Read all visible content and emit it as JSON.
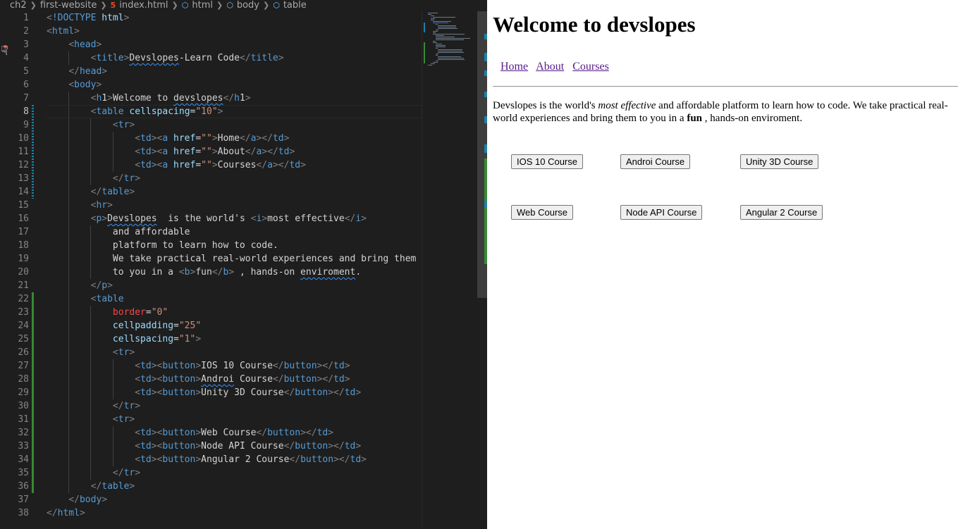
{
  "breadcrumb": [
    "ch2",
    "first-website",
    "index.html",
    "html",
    "body",
    "table"
  ],
  "active_line": 8,
  "code_lines": [
    "<!DOCTYPE html>",
    "<html>",
    "    <head>",
    "        <title>Devslopes-Learn Code</title>",
    "    </head>",
    "    <body>",
    "        <h1>Welcome to devslopes</h1>",
    "        <table cellspacing=\"10\">",
    "            <tr>",
    "                <td><a href=\"\">Home</a></td>",
    "                <td><a href=\"\">About</a></td>",
    "                <td><a href=\"\">Courses</a></td>",
    "            </tr>",
    "        </table>",
    "        <hr>",
    "        <p>Devslopes  is the world's <i>most effective</i>",
    "            and affordable",
    "            platform to learn how to code.",
    "            We take practical real-world experiences and bring them",
    "            to you in a <b>fun</b> , hands-on enviroment.",
    "        </p>",
    "        <table",
    "            border=\"0\"",
    "            cellpadding=\"25\"",
    "            cellspacing=\"1\">",
    "            <tr>",
    "                <td><button>IOS 10 Course</button></td>",
    "                <td><button>Androi Course</button></td>",
    "                <td><button>Unity 3D Course</button></td>",
    "            </tr>",
    "            <tr>",
    "                <td><button>Web Course</button></td>",
    "                <td><button>Node API Course</button></td>",
    "                <td><button>Angular 2 Course</button></td>",
    "            </tr>",
    "        </table>",
    "    </body>",
    "</html>"
  ],
  "squiggles": [
    "Devslopes",
    "devslopes",
    "Devslopes",
    "enviroment",
    "Androi"
  ],
  "preview": {
    "heading": "Welcome to devslopes",
    "nav_links": [
      "Home",
      "About",
      "Courses"
    ],
    "paragraph": {
      "before_italic": "Devslopes is the world's ",
      "italic": "most effective",
      "middle": " and affordable platform to learn how to code. We take practical real-world experiences and bring them to you in a ",
      "bold": "fun",
      "after": " , hands-on enviroment."
    },
    "buttons": [
      "IOS 10 Course",
      "Androi Course",
      "Unity 3D Course",
      "Web Course",
      "Node API Course",
      "Angular 2 Course"
    ]
  },
  "colors": {
    "editor_bg": "#1e1e1e",
    "tag": "#569cd6",
    "attr": "#9cdcfe",
    "string": "#ce9178",
    "bracket": "#808080",
    "link_visited": "#551a8b",
    "diff_added": "#388a34",
    "diff_modified": "#1b81a8"
  }
}
